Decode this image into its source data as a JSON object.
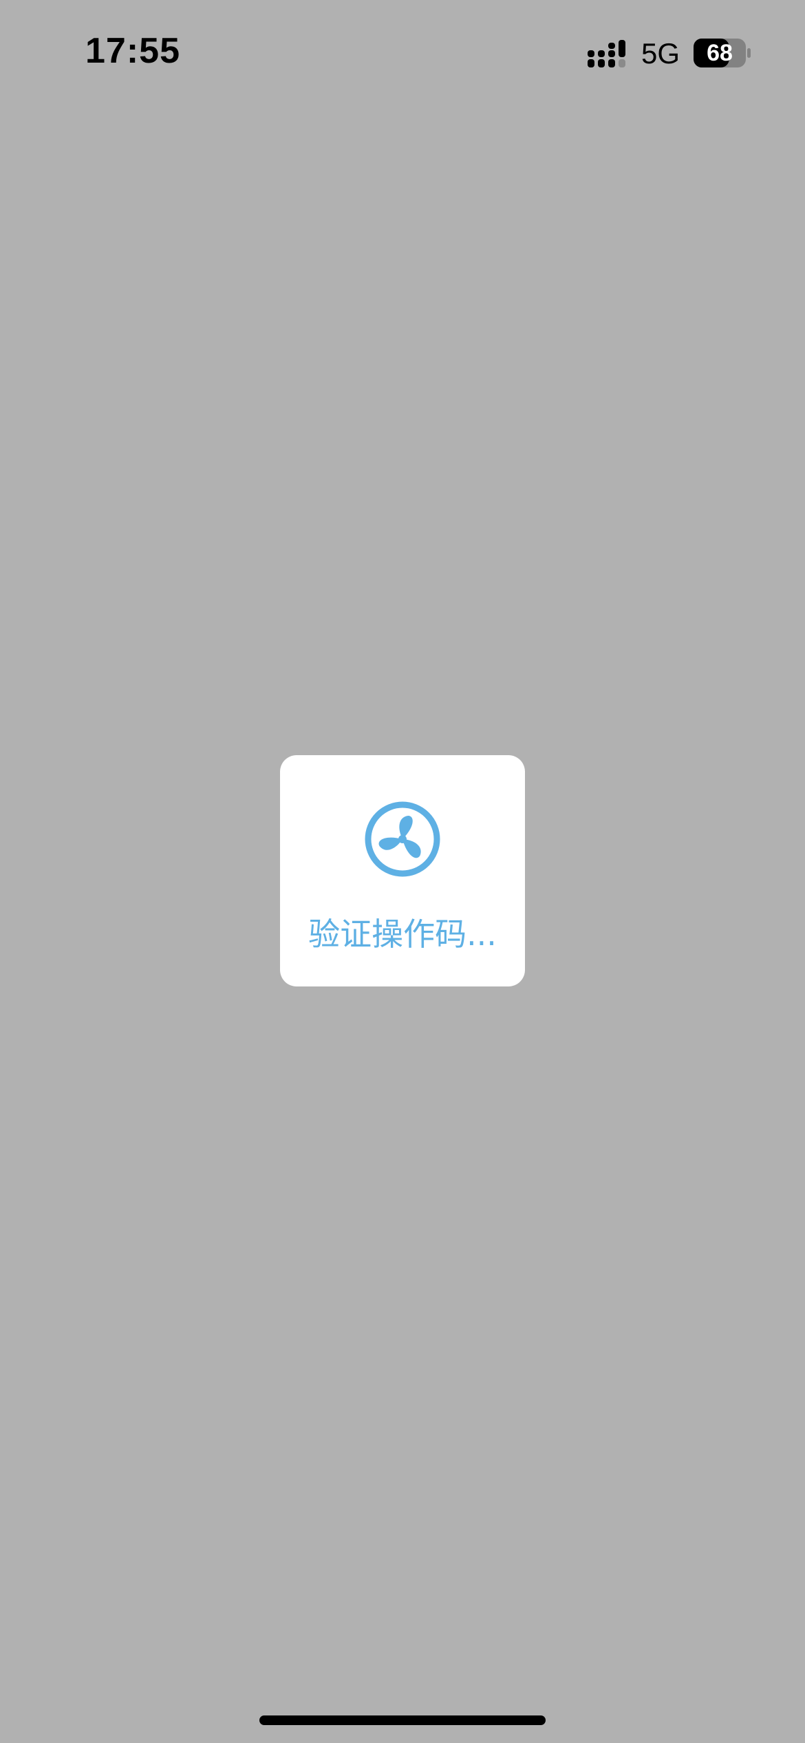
{
  "status_bar": {
    "time": "17:55",
    "network": "5G",
    "battery_level": "68",
    "battery_fill_percent": 68,
    "signal_icon": "cellular-signal-icon",
    "battery_icon": "battery-icon"
  },
  "loading_modal": {
    "icon": "fan-loading-icon",
    "text": "验证操作码...",
    "accent_color": "#5eb0e4"
  },
  "overlay_color": "#b1b1b1"
}
